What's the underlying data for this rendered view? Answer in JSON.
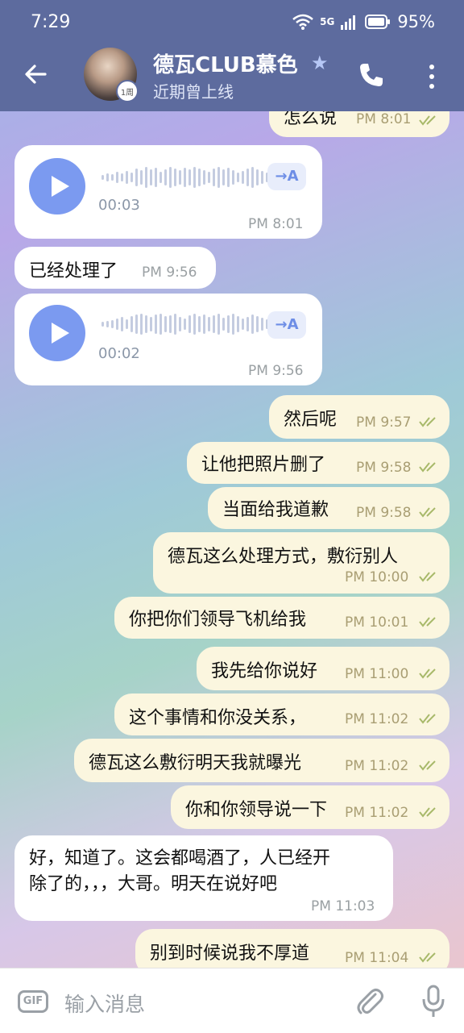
{
  "status": {
    "time": "7:29",
    "network": "5G",
    "battery": "95%"
  },
  "header": {
    "title": "德瓦CLUB慕色",
    "subtitle": "近期曾上线",
    "avatar_badge": "1周"
  },
  "messages": [
    {
      "type": "text",
      "dir": "out",
      "text": "怎么说",
      "time": "PM 8:01"
    },
    {
      "type": "voice",
      "dir": "in",
      "duration": "00:03",
      "time": "PM 8:01",
      "translate": "→A"
    },
    {
      "type": "text",
      "dir": "in",
      "text": "已经处理了",
      "time": "PM 9:56"
    },
    {
      "type": "voice",
      "dir": "in",
      "duration": "00:02",
      "time": "PM 9:56",
      "translate": "→A"
    },
    {
      "type": "text",
      "dir": "out",
      "text": "然后呢",
      "time": "PM 9:57"
    },
    {
      "type": "text",
      "dir": "out",
      "text": "让他把照片删了",
      "time": "PM 9:58"
    },
    {
      "type": "text",
      "dir": "out",
      "text": "当面给我道歉",
      "time": "PM 9:58"
    },
    {
      "type": "text",
      "dir": "out",
      "text": "德瓦这么处理方式，敷衍别人",
      "time": "PM 10:00"
    },
    {
      "type": "text",
      "dir": "out",
      "text": "你把你们领导飞机给我",
      "time": "PM 10:01"
    },
    {
      "type": "text",
      "dir": "out",
      "text": "我先给你说好",
      "time": "PM 11:00"
    },
    {
      "type": "text",
      "dir": "out",
      "text": "这个事情和你没关系，",
      "time": "PM 11:02"
    },
    {
      "type": "text",
      "dir": "out",
      "text": "德瓦这么敷衍明天我就曝光",
      "time": "PM 11:02"
    },
    {
      "type": "text",
      "dir": "out",
      "text": "你和你领导说一下",
      "time": "PM 11:02"
    },
    {
      "type": "text",
      "dir": "in",
      "text_line1": "好，知道了。这会都喝酒了，人已经开",
      "text_line2": "除了的，，，大哥。明天在说好吧",
      "time": "PM 11:03"
    },
    {
      "type": "text",
      "dir": "out",
      "text": "别到时候说我不厚道",
      "time": "PM 11:04"
    }
  ],
  "composer": {
    "gif_label": "GIF",
    "placeholder": "输入消息"
  },
  "colors": {
    "header": "#5d6b9e",
    "incoming": "#ffffff",
    "outgoing": "#fbf6df",
    "accent": "#7b9af0",
    "ticks": "#a8b96a"
  }
}
